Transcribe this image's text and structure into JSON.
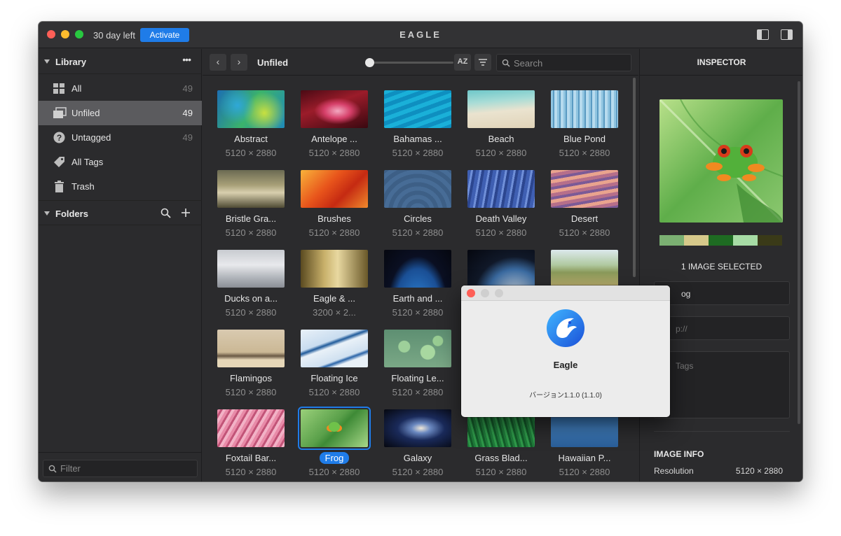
{
  "titlebar": {
    "trial_text": "30 day left",
    "activate_label": "Activate",
    "app_title": "EAGLE"
  },
  "sidebar": {
    "library": {
      "title": "Library",
      "more": "•••",
      "items": [
        {
          "label": "All",
          "count": "49",
          "icon": "grid-icon"
        },
        {
          "label": "Unfiled",
          "count": "49",
          "icon": "unfiled-icon",
          "active": true
        },
        {
          "label": "Untagged",
          "count": "49",
          "icon": "question-icon"
        },
        {
          "label": "All Tags",
          "count": "",
          "icon": "tag-icon"
        },
        {
          "label": "Trash",
          "count": "",
          "icon": "trash-icon"
        }
      ]
    },
    "folders": {
      "title": "Folders"
    },
    "filter_placeholder": "Filter"
  },
  "toolbar": {
    "back": "‹",
    "forward": "›",
    "breadcrumb": "Unfiled",
    "sort_label": "AZ",
    "search_placeholder": "Search"
  },
  "grid": {
    "items": [
      {
        "name": "Abstract",
        "dim": "5120 × 2880"
      },
      {
        "name": "Antelope ...",
        "dim": "5120 × 2880"
      },
      {
        "name": "Bahamas ...",
        "dim": "5120 × 2880"
      },
      {
        "name": "Beach",
        "dim": "5120 × 2880"
      },
      {
        "name": "Blue Pond",
        "dim": "5120 × 2880"
      },
      {
        "name": "Bristle Gra...",
        "dim": "5120 × 2880"
      },
      {
        "name": "Brushes",
        "dim": "5120 × 2880"
      },
      {
        "name": "Circles",
        "dim": "5120 × 2880"
      },
      {
        "name": "Death Valley",
        "dim": "5120 × 2880"
      },
      {
        "name": "Desert",
        "dim": "5120 × 2880"
      },
      {
        "name": "Ducks on a...",
        "dim": "5120 × 2880"
      },
      {
        "name": "Eagle & ...",
        "dim": "3200 × 2..."
      },
      {
        "name": "Earth and ...",
        "dim": "5120 × 2880"
      },
      {
        "name": "",
        "dim": ""
      },
      {
        "name": "",
        "dim": ""
      },
      {
        "name": "Flamingos",
        "dim": "5120 × 2880"
      },
      {
        "name": "Floating Ice",
        "dim": "5120 × 2880"
      },
      {
        "name": "Floating Le...",
        "dim": "5120 × 2880"
      },
      {
        "name": "",
        "dim": ""
      },
      {
        "name": "",
        "dim": ""
      },
      {
        "name": "Foxtail Bar...",
        "dim": "5120 × 2880"
      },
      {
        "name": "Frog",
        "dim": "5120 × 2880",
        "selected": true
      },
      {
        "name": "Galaxy",
        "dim": "5120 × 2880"
      },
      {
        "name": "Grass Blad...",
        "dim": "5120 × 2880"
      },
      {
        "name": "Hawaiian P...",
        "dim": "5120 × 2880"
      }
    ]
  },
  "inspector": {
    "title": "INSPECTOR",
    "palette": [
      "#7bb072",
      "#d6c98a",
      "#1e6b22",
      "#a7dca5",
      "#3a3a18"
    ],
    "selected_count": "1 IMAGE SELECTED",
    "name_value": "og",
    "url_placeholder": "p://",
    "tags_placeholder": "Tags",
    "info_title": "IMAGE INFO",
    "resolution_label": "Resolution",
    "resolution_value": "5120 × 2880"
  },
  "about": {
    "app_name": "Eagle",
    "version": "バージョン1.1.0 (1.1.0)"
  },
  "colors": {
    "accent": "#1f7ce8",
    "close": "#fe5f57",
    "minimize": "#febc2e",
    "zoom": "#28c840"
  }
}
